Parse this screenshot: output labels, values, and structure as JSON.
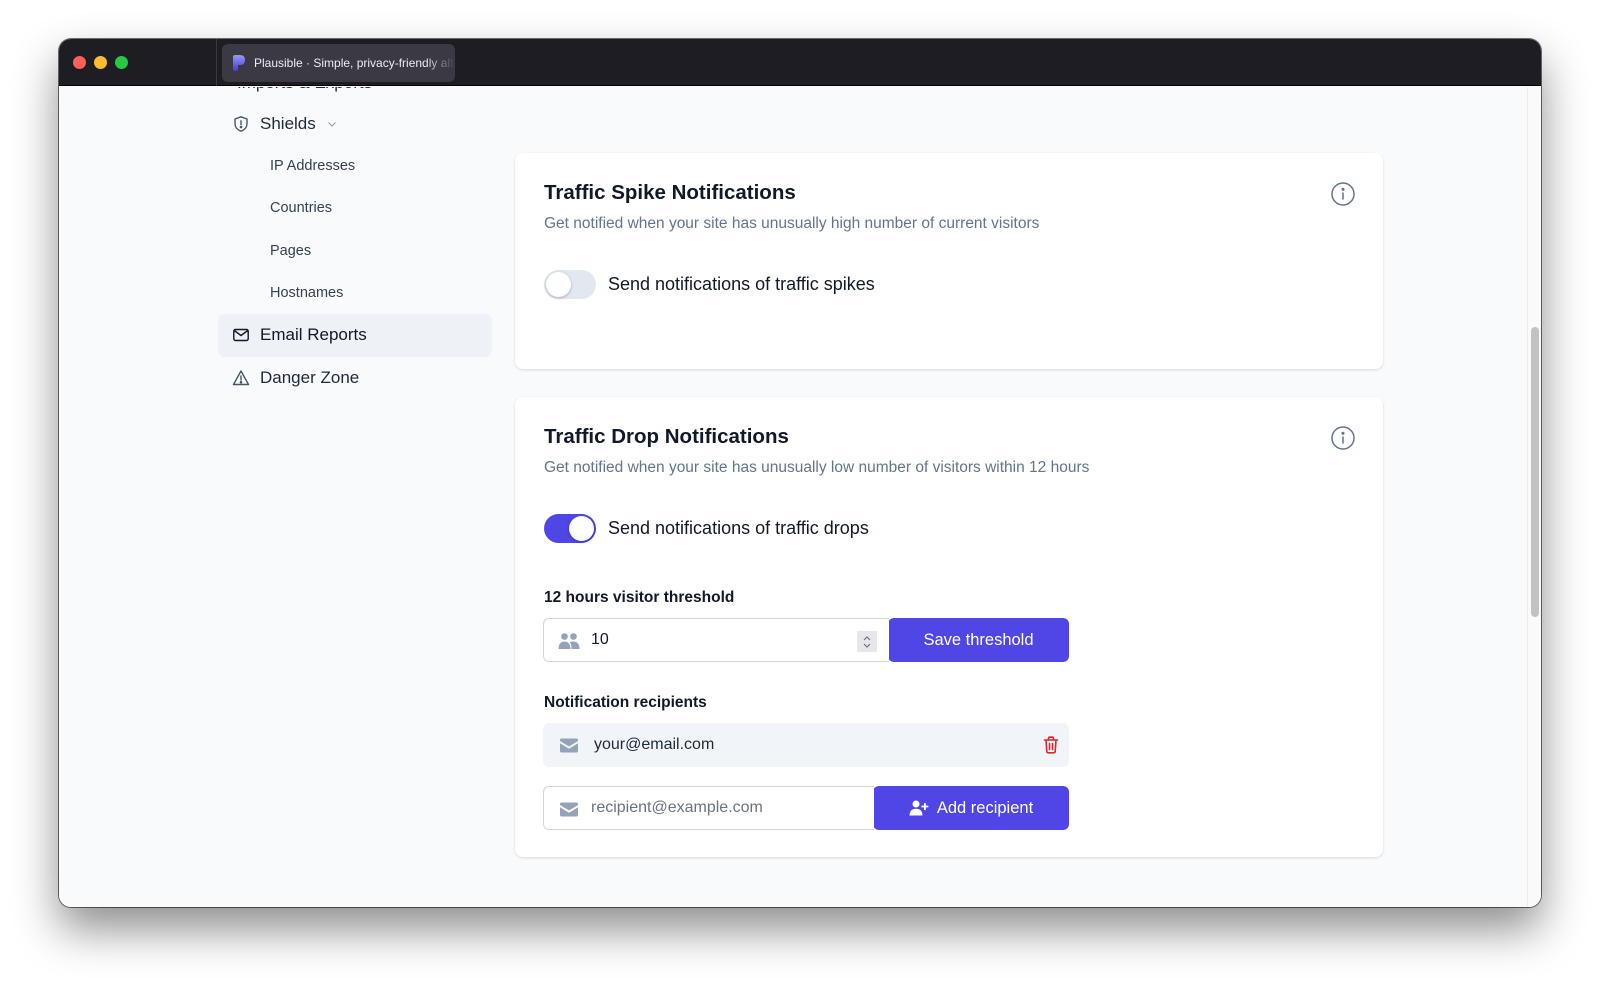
{
  "browser": {
    "tab_title": "Plausible · Simple, privacy-friendly alternative to Google Analytics",
    "tab_icon": "plausible-logo-icon"
  },
  "sidebar": {
    "cut_item": "Imports & Exports",
    "shields": {
      "label": "Shields",
      "icon": "shield-icon",
      "expanded": true
    },
    "sub_items": [
      {
        "label": "IP Addresses"
      },
      {
        "label": "Countries"
      },
      {
        "label": "Pages"
      },
      {
        "label": "Hostnames"
      }
    ],
    "email_reports": {
      "label": "Email Reports",
      "icon": "envelope-icon",
      "active": true
    },
    "danger_zone": {
      "label": "Danger Zone",
      "icon": "warning-icon"
    }
  },
  "spike": {
    "title": "Traffic Spike Notifications",
    "description": "Get notified when your site has unusually high number of current visitors",
    "toggle_label": "Send notifications of traffic spikes",
    "enabled": false
  },
  "drop": {
    "title": "Traffic Drop Notifications",
    "description": "Get notified when your site has unusually low number of visitors within 12 hours",
    "toggle_label": "Send notifications of traffic drops",
    "enabled": true,
    "threshold_label": "12 hours visitor threshold",
    "threshold_value": "10",
    "save_label": "Save threshold",
    "recipients_label": "Notification recipients",
    "recipients": [
      {
        "email": "your@email.com"
      }
    ],
    "new_recipient_placeholder": "recipient@example.com",
    "add_label": "Add recipient"
  },
  "colors": {
    "accent": "#4f46e5",
    "danger": "#dc2626",
    "muted_text": "#64748b"
  }
}
